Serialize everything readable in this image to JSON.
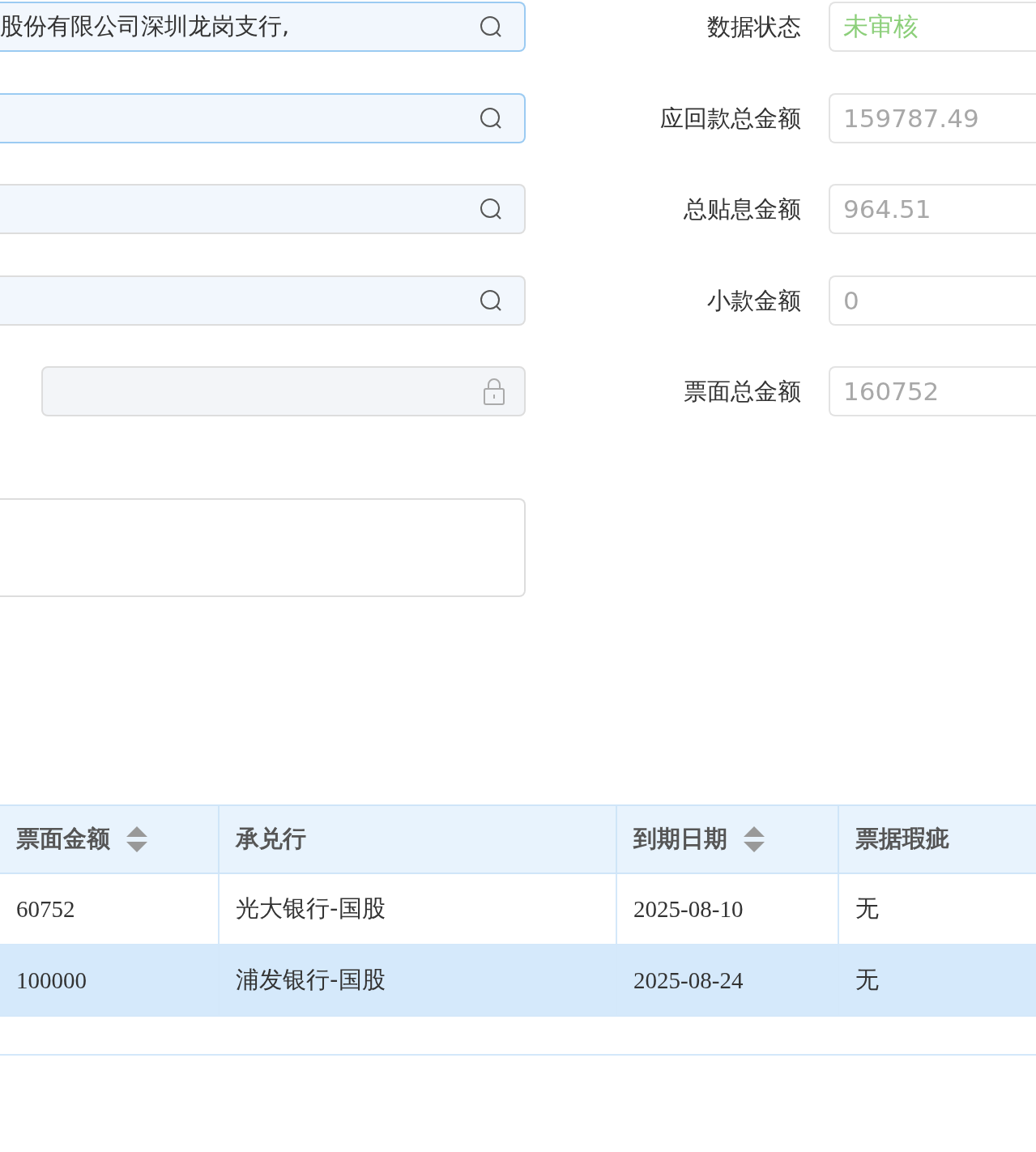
{
  "left_fields": [
    {
      "kind": "search",
      "value": "股份有限公司深圳龙岗支行,",
      "active": true
    },
    {
      "kind": "search",
      "active": true
    },
    {
      "kind": "search",
      "active": false
    },
    {
      "kind": "search",
      "active": false
    },
    {
      "kind": "locked",
      "active": false
    }
  ],
  "right_fields": [
    {
      "label": "数据状态",
      "value": "未审核",
      "kind": "status"
    },
    {
      "label": "应回款总金额",
      "value": "159787.49",
      "kind": "amount"
    },
    {
      "label": "总贴息金额",
      "value": "964.51",
      "kind": "amount"
    },
    {
      "label": "小款金额",
      "value": "0",
      "kind": "amount"
    },
    {
      "label": "票面总金额",
      "value": "160752",
      "kind": "amount"
    }
  ],
  "table": {
    "columns": [
      {
        "label": "票面金额",
        "sortable": true
      },
      {
        "label": "承兑行",
        "sortable": false
      },
      {
        "label": "到期日期",
        "sortable": true
      },
      {
        "label": "票据瑕疵",
        "sortable": false
      }
    ],
    "rows": [
      {
        "cells": [
          "60752",
          "光大银行-国股",
          "2025-08-10",
          "无"
        ],
        "selected": false
      },
      {
        "cells": [
          "100000",
          "浦发银行-国股",
          "2025-08-24",
          "无"
        ],
        "selected": true
      }
    ]
  }
}
